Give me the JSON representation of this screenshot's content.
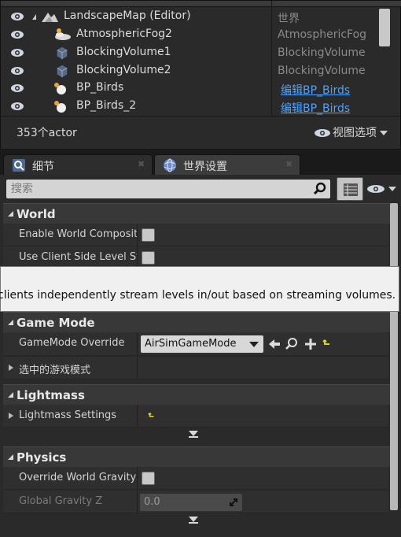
{
  "outliner": {
    "rows": [
      {
        "name": "LandscapeMap (Editor)",
        "type": "世界",
        "link": false,
        "icon": "world-icon"
      },
      {
        "name": "AtmosphericFog2",
        "type": "AtmosphericFog",
        "link": false,
        "icon": "fog-icon"
      },
      {
        "name": "BlockingVolume1",
        "type": "BlockingVolume",
        "link": false,
        "icon": "cube-icon"
      },
      {
        "name": "BlockingVolume2",
        "type": "BlockingVolume",
        "link": false,
        "icon": "cube-icon"
      },
      {
        "name": "BP_Birds",
        "type": "编辑BP_Birds",
        "link": true,
        "icon": "blueprint-actor-icon"
      },
      {
        "name": "BP_Birds_2",
        "type": "编辑BP_Birds",
        "link": true,
        "icon": "blueprint-actor-icon"
      }
    ],
    "actor_count": "353个actor",
    "view_options": "视图选项"
  },
  "tabs": [
    {
      "label": "细节",
      "icon": "magnifier-icon",
      "active": false
    },
    {
      "label": "世界设置",
      "icon": "globe-icon",
      "active": true
    }
  ],
  "details": {
    "search_placeholder": "搜索",
    "categories": {
      "world": {
        "label": "World",
        "enable_world_composition": "Enable World Composition",
        "use_client_side_level": "Use Client Side Level Streaming Volumes"
      },
      "game_mode": {
        "label": "Game Mode",
        "gamemode_override_label": "GameMode Override",
        "gamemode_override_value": "AirSimGameMode",
        "selected_game_mode": "选中的游戏模式"
      },
      "lightmass": {
        "label": "Lightmass",
        "lightmass_settings": "Lightmass Settings"
      },
      "physics": {
        "label": "Physics",
        "override_world_gravity": "Override World Gravity",
        "global_gravity_z_label": "Global Gravity Z",
        "global_gravity_z_value": "0.0"
      }
    }
  },
  "tooltip": {
    "text": "clients independently stream levels in/out based on streaming volumes."
  },
  "colors": {
    "accent_link": "#4da3ff",
    "reset_arrow": "#e0d020"
  }
}
